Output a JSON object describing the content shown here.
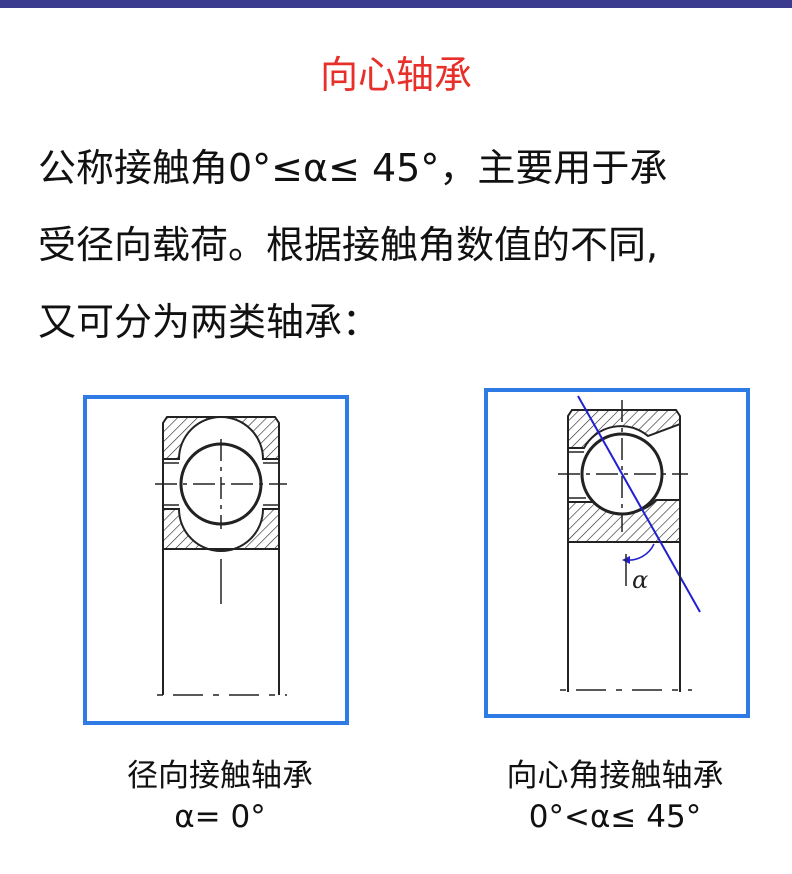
{
  "slide": {
    "title": "向心轴承",
    "body_lines": [
      "公称接触角0°≤α≤ 45°，主要用于承",
      "受径向载荷。根据接触角数值的不同,",
      "又可分为两类轴承："
    ]
  },
  "figures": [
    {
      "caption_name": "径向接触轴承",
      "caption_angle": "α= 0°"
    },
    {
      "angle_symbol": "α",
      "caption_name": "向心角接触轴承",
      "caption_angle": "0°<α≤ 45°"
    }
  ],
  "colors": {
    "title": "#e8302a",
    "frame": "#2f7be6",
    "top_bar": "#3b3b8f",
    "contact_line": "#2020d0"
  }
}
